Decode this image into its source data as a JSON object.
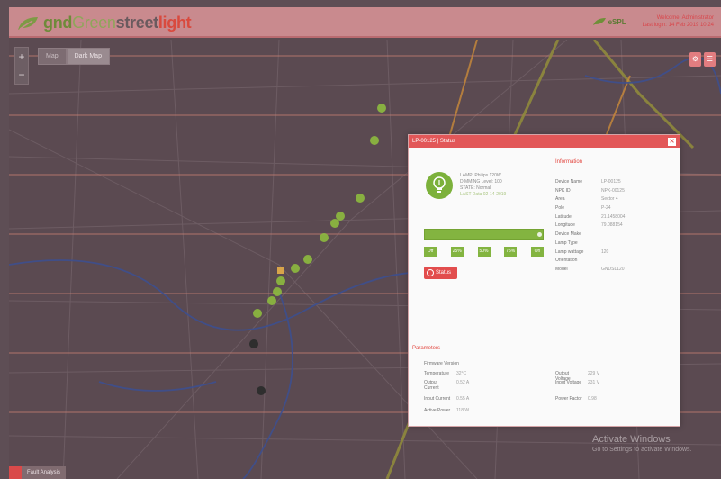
{
  "header": {
    "brand_parts": [
      "gnd",
      "Green",
      "street",
      "light"
    ],
    "partner_name": "eSPL",
    "user_line1": "Welcome! Administrator",
    "user_line2": "Last login: 14 Feb 2019 10:24"
  },
  "map": {
    "layers": [
      "Map",
      "Dark Map"
    ],
    "zoom_in": "+",
    "zoom_out": "−",
    "tools": [
      "⚙",
      "☰"
    ]
  },
  "popup": {
    "title": "LP-00125 | Status",
    "close": "✕",
    "information_title": "Information",
    "lamp_meta": [
      "LAMP: Philips 120W",
      "DIMMING Level: 100",
      "STATE: Normal",
      "LAST Data 02-14-2019"
    ],
    "dim_steps": [
      "Off",
      "25%",
      "50%",
      "75%",
      "On"
    ],
    "status_button": "Status",
    "info_rows": [
      {
        "label": "Device Name",
        "value": "LP-00125"
      },
      {
        "label": "NPK ID",
        "value": "NPK-00125"
      },
      {
        "label": "Area",
        "value": "Sector 4"
      },
      {
        "label": "Pole",
        "value": "P-24"
      },
      {
        "label": "Latitude",
        "value": "21.1458004"
      },
      {
        "label": "Longitude",
        "value": "79.088154"
      },
      {
        "label": "Device Make",
        "value": ""
      },
      {
        "label": "Lamp Type",
        "value": ""
      },
      {
        "label": "Lamp wattage",
        "value": "120"
      },
      {
        "label": "Orientation",
        "value": ""
      },
      {
        "label": "Model",
        "value": "GNDSL120"
      }
    ],
    "params_title": "Parameters",
    "params_subtitle": "Firmware Version",
    "params_left": [
      {
        "label": "Temperature",
        "value": "32°C"
      },
      {
        "label": "Output Current",
        "value": "0.52 A"
      },
      {
        "label": "Input Current",
        "value": "0.55 A"
      },
      {
        "label": "Active Power",
        "value": "118 W"
      }
    ],
    "params_right": [
      {
        "label": "Output Voltage",
        "value": "229 V"
      },
      {
        "label": "Input Voltage",
        "value": "231 V"
      },
      {
        "label": "Power Factor",
        "value": "0.98"
      }
    ]
  },
  "watermark": {
    "line1": "Activate Windows",
    "line2": "Go to Settings to activate Windows."
  },
  "bottom_tab": {
    "label": "Fault Analysis"
  }
}
